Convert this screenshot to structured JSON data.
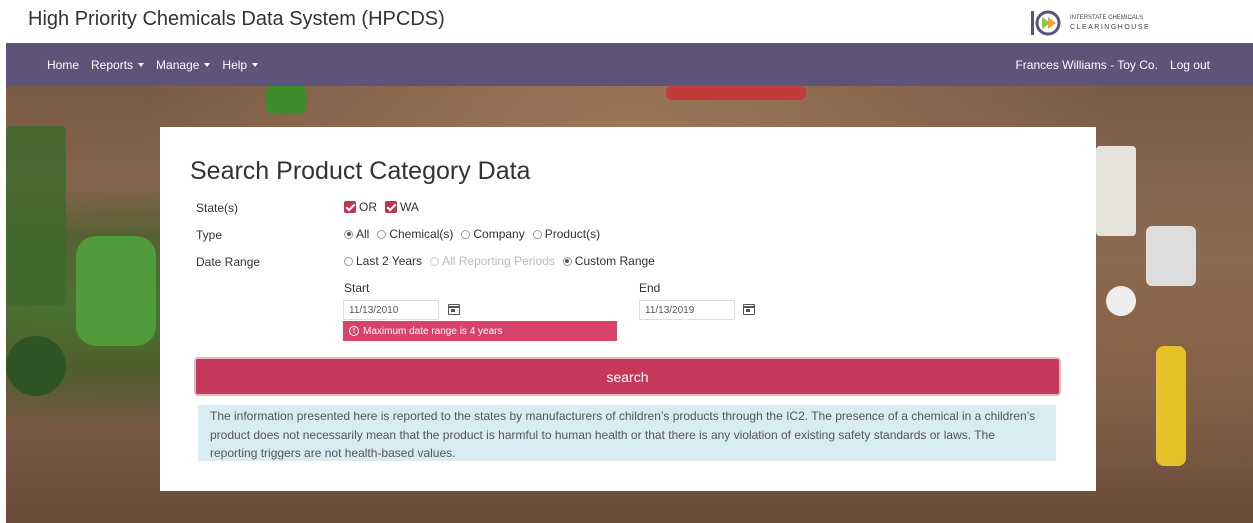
{
  "header": {
    "title": "High Priority Chemicals Data System (HPCDS)",
    "logo": {
      "line1": "INTERSTATE CHEMICALS",
      "line2": "CLEARINGHOUSE",
      "mark": "IC2"
    }
  },
  "navbar": {
    "items": [
      {
        "label": "Home",
        "dropdown": false
      },
      {
        "label": "Reports",
        "dropdown": true
      },
      {
        "label": "Manage",
        "dropdown": true
      },
      {
        "label": "Help",
        "dropdown": true
      }
    ],
    "user": "Frances Williams - Toy Co.",
    "logout": "Log out"
  },
  "form": {
    "title": "Search Product Category Data",
    "states": {
      "label": "State(s)",
      "options": [
        {
          "label": "OR",
          "checked": true
        },
        {
          "label": "WA",
          "checked": true
        }
      ]
    },
    "type": {
      "label": "Type",
      "options": [
        {
          "label": "All",
          "selected": true
        },
        {
          "label": "Chemical(s)",
          "selected": false
        },
        {
          "label": "Company",
          "selected": false
        },
        {
          "label": "Product(s)",
          "selected": false
        }
      ]
    },
    "date_range": {
      "label": "Date Range",
      "options": [
        {
          "label": "Last 2 Years",
          "selected": false,
          "disabled": false
        },
        {
          "label": "All Reporting Periods",
          "selected": false,
          "disabled": true
        },
        {
          "label": "Custom Range",
          "selected": true,
          "disabled": false
        }
      ],
      "start_label": "Start",
      "start_value": "11/13/2010",
      "end_label": "End",
      "end_value": "11/13/2019",
      "error": "Maximum date range is 4 years"
    },
    "search_label": "search",
    "info": "The information presented here is reported to the states by manufacturers of children’s products through the IC2. The presence of a chemical in a children’s product does not necessarily mean that the product is harmful to human health or that there is any violation of existing safety standards or laws. The reporting triggers are not health-based values."
  },
  "colors": {
    "nav": "#5e5378",
    "accent": "#c6385a",
    "error": "#d9436a",
    "info_bg": "#d8ecf4"
  }
}
